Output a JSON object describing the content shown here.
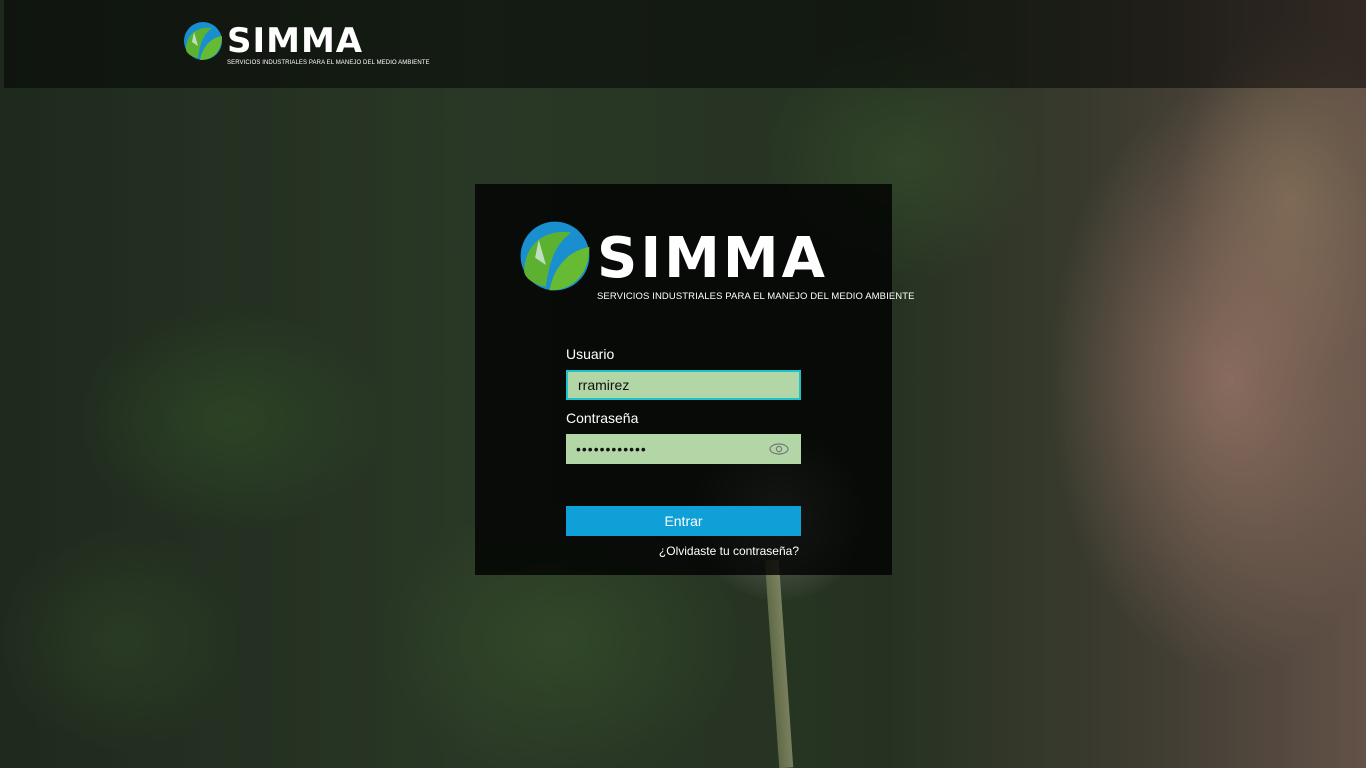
{
  "brand": {
    "name": "SIMMA",
    "tagline": "SERVICIOS INDUSTRIALES PARA EL MANEJO DEL MEDIO AMBIENTE",
    "colors": {
      "blue": "#1a8fd0",
      "green": "#5cb230"
    }
  },
  "login": {
    "username_label": "Usuario",
    "username_value": "rramirez",
    "password_label": "Contraseña",
    "password_value": "••••••••••••",
    "submit_label": "Entrar",
    "forgot_link": "¿Olvidaste tu contraseña?"
  },
  "icons": {
    "password_toggle": "eye-icon"
  },
  "colors": {
    "input_bg": "#b2d6a6",
    "focus_border": "#1ec4cc",
    "button": "#0fa0d7"
  }
}
